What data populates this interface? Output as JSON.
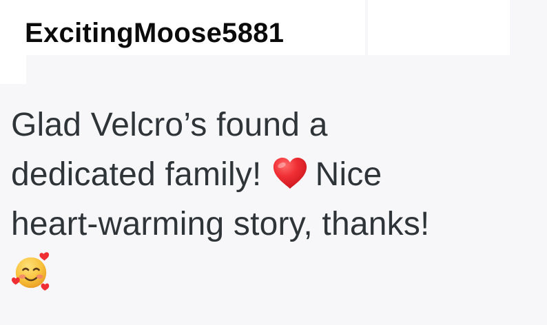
{
  "comment": {
    "username": "ExcitingMoose5881",
    "line1": "Glad Velcro’s found a",
    "line2_before": "dedicated family!",
    "line2_after": "Nice",
    "line3": "heart-warming story, thanks!",
    "emojis": {
      "inline_heart": "red-heart-icon",
      "trailing": "smiling-face-with-hearts-icon"
    }
  },
  "colors": {
    "background": "#f7f7f9",
    "header_background": "#ffffff",
    "username_text": "#0b0b0c",
    "body_text": "#2e3438",
    "heart_red": "#e0262f",
    "emoji_face": "#f8c23c"
  }
}
